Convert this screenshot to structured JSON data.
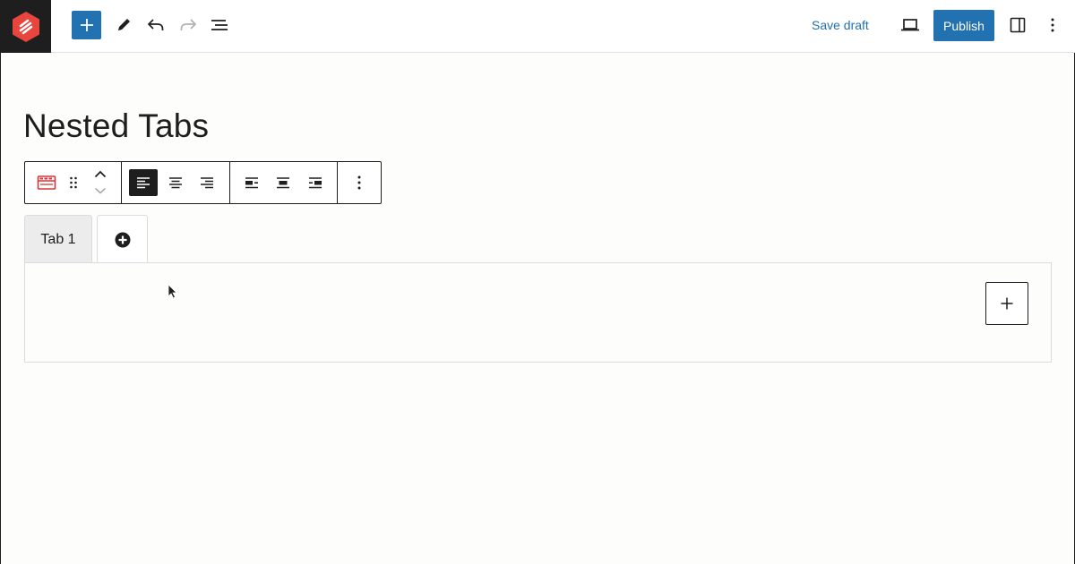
{
  "topbar": {
    "logo_icon": "plugin-logo-icon",
    "add_block_label": "Add block",
    "tools": [
      "pencil-icon",
      "undo-icon",
      "redo-icon",
      "list-view-icon"
    ],
    "save_draft_label": "Save draft",
    "preview_icon": "laptop-icon",
    "publish_label": "Publish",
    "settings_icon": "sidebar-toggle-icon",
    "options_icon": "more-vertical-icon",
    "accent_color": "#2271b1"
  },
  "post": {
    "title": "Nested Tabs"
  },
  "block_toolbar": {
    "block_icon": "tabs-block-icon",
    "block_icon_color": "#d63638",
    "alignment_active": "align-left"
  },
  "tabs": {
    "items": [
      "Tab 1"
    ],
    "add_tab_icon": "plus-circle-icon"
  },
  "panel": {
    "inserter_icon": "plus-icon"
  }
}
